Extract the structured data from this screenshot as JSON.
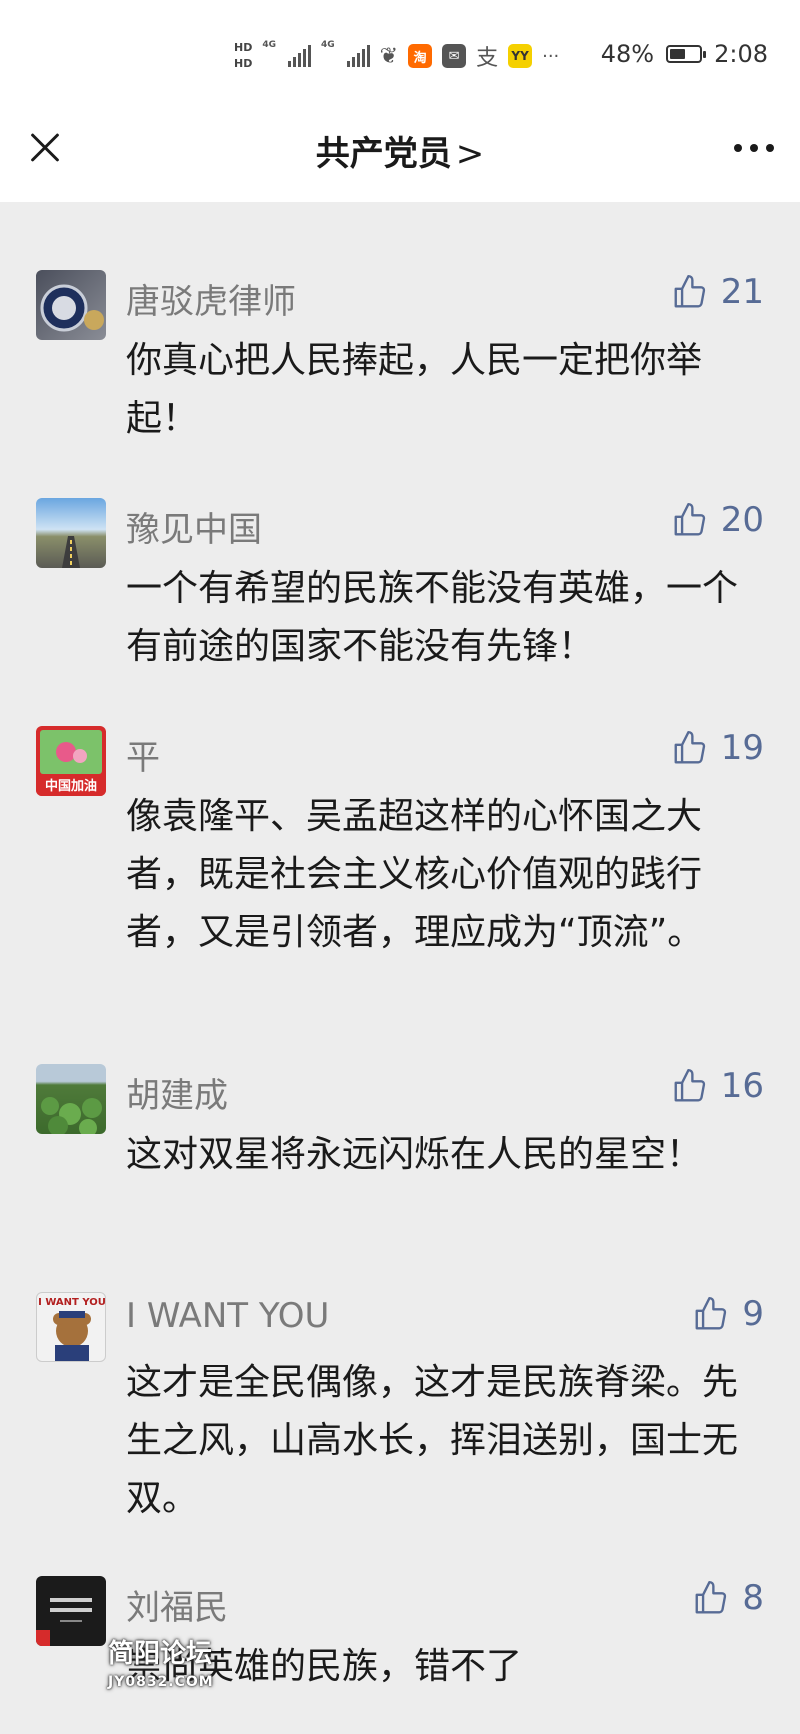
{
  "status_bar": {
    "hd1": "HD",
    "hd2": "HD",
    "net1": "4G",
    "net2": "4G",
    "battery": "48%",
    "time": "2:08",
    "more": "···"
  },
  "nav": {
    "title": "共产党员",
    "chevron": ">"
  },
  "comments": [
    {
      "name": "唐驳虎律师",
      "likes": "21",
      "text": "你真心把人民捧起，人民一定把你举起！"
    },
    {
      "name": "豫见中国",
      "likes": "20",
      "text": "一个有希望的民族不能没有英雄，一个有前途的国家不能没有先锋！"
    },
    {
      "name": "平",
      "likes": "19",
      "text": "像袁隆平、吴孟超这样的心怀国之大者，既是社会主义核心价值观的践行者，又是引领者，理应成为“顶流”。"
    },
    {
      "name": "胡建成",
      "likes": "16",
      "text": "这对双星将永远闪烁在人民的星空！"
    },
    {
      "name": "I WANT YOU",
      "likes": "9",
      "text": "这才是全民偶像，这才是民族脊梁。先生之风，山高水长，挥泪送别，国士无双。"
    },
    {
      "name": "刘福民",
      "likes": "8",
      "text": "崇尚英雄的民族，错不了"
    }
  ],
  "avatar_labels": {
    "ping": "中国加油",
    "iwantyou": "I WANT YOU"
  },
  "watermark": {
    "line1": "简阳论坛",
    "line2": "JY0832.COM"
  },
  "colors": {
    "background": "#ededed",
    "link_blue": "#576b95",
    "name_gray": "#7a7a7a"
  }
}
